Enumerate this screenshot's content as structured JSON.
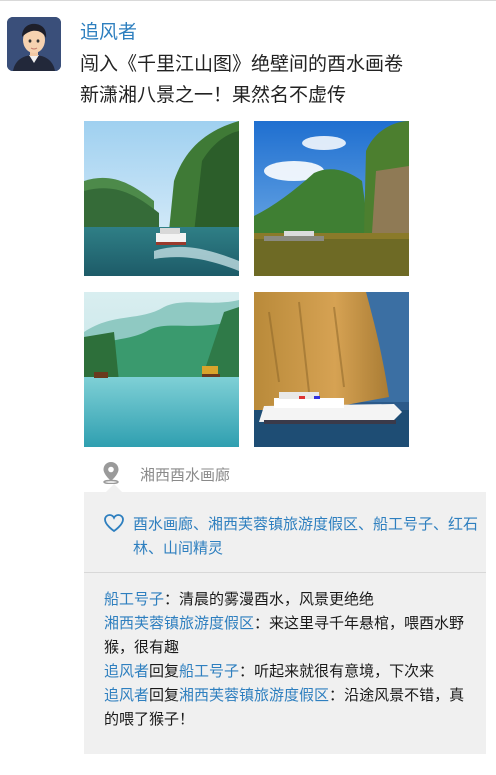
{
  "post": {
    "username": "追风者",
    "text_line1": "闯入《千里江山图》绝壁间的酉水画卷",
    "text_line2": "新潇湘八景之一！果然名不虚传"
  },
  "location": {
    "label": "湘西酉水画廊",
    "icon": "location-pin-icon"
  },
  "likes": {
    "icon": "heart-icon",
    "names_line": "酉水画廊、湘西芙蓉镇旅游度假区、船工号子、红石林、山间精灵"
  },
  "comments": [
    {
      "author": "船工号子",
      "reply_to": "",
      "text": "清晨的雾漫酉水，风景更绝绝"
    },
    {
      "author": "湘西芙蓉镇旅游度假区",
      "reply_to": "",
      "text": "来这里寻千年悬棺，喂酉水野猴，很有趣"
    },
    {
      "author": "追风者",
      "reply_word": "回复",
      "reply_to": "船工号子",
      "text": "听起来就很有意境，下次来"
    },
    {
      "author": "追风者",
      "reply_word": "回复",
      "reply_to": "湘西芙蓉镇旅游度假区",
      "text": "沿途风景不错，真的喂了猴子！"
    }
  ],
  "colors": {
    "name_blue": "#2e7fbf",
    "panel_bg": "#f0f0f0"
  }
}
